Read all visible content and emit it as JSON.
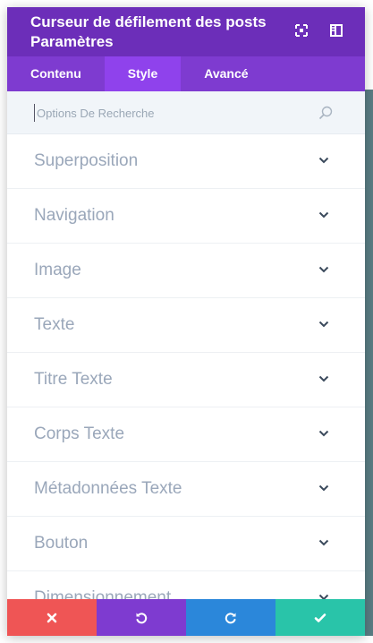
{
  "header": {
    "title_line1": "Curseur de défilement des posts",
    "title_line2": "Paramètres",
    "expand_icon": "expand-icon",
    "sidebar_icon": "sidebar-toggle-icon"
  },
  "tabs": [
    {
      "label": "Contenu",
      "active": false
    },
    {
      "label": "Style",
      "active": true
    },
    {
      "label": "Avancé",
      "active": false
    }
  ],
  "search": {
    "placeholder": "Options De Recherche",
    "icon": "search-icon"
  },
  "sections": [
    {
      "label": "Superposition"
    },
    {
      "label": "Navigation"
    },
    {
      "label": "Image"
    },
    {
      "label": "Texte"
    },
    {
      "label": "Titre Texte"
    },
    {
      "label": "Corps Texte"
    },
    {
      "label": "Métadonnées Texte"
    },
    {
      "label": "Bouton"
    },
    {
      "label": "Dimensionnement"
    }
  ],
  "footer": {
    "discard_icon": "close-icon",
    "undo_icon": "undo-icon",
    "redo_icon": "redo-icon",
    "save_icon": "check-icon"
  },
  "colors": {
    "header": "#6c2eb9",
    "tabs": "#7e3bd0",
    "tab_active": "#8f42ec",
    "discard": "#ef5555",
    "undo": "#7e3bd0",
    "redo": "#2b87da",
    "save": "#29c4a9"
  }
}
